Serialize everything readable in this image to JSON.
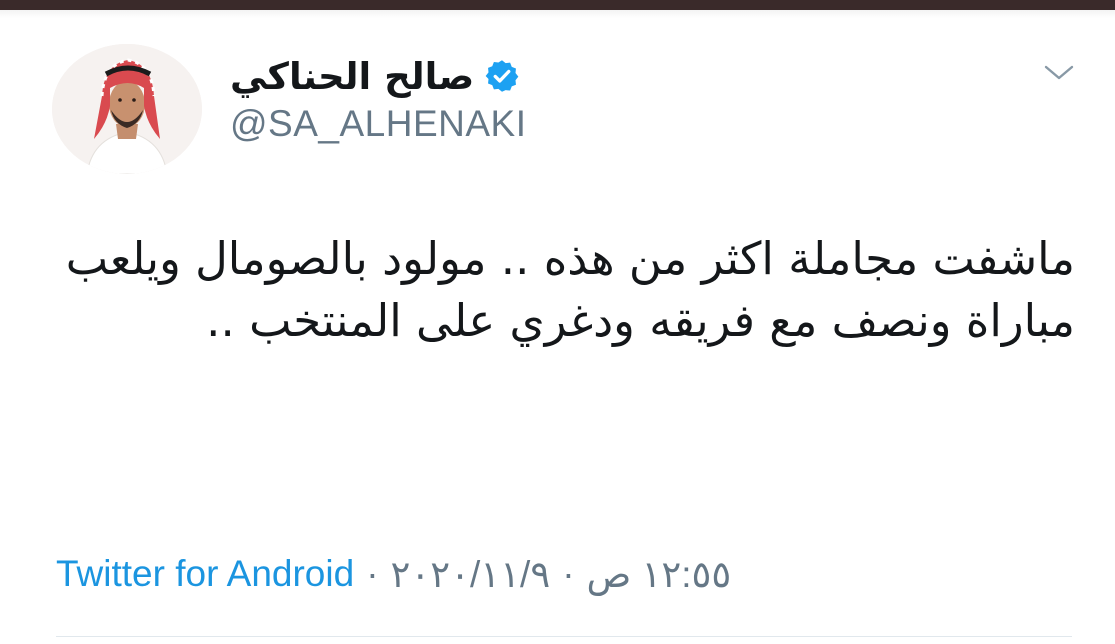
{
  "tweet": {
    "author": {
      "display_name": "صالح الحناكي",
      "handle": "@SA_ALHENAKI",
      "verified": true
    },
    "text": "ماشفت مجاملة اكثر من هذه .. مولود بالصومال ويلعب مباراة ونصف مع فريقه ودغري على المنتخب ..",
    "time": "١٢:٥٥ ص",
    "date": "٢٠٢٠/١١/٩",
    "separator": "·",
    "source": "Twitter for Android"
  },
  "colors": {
    "text": "#14171a",
    "secondary": "#657786",
    "link": "#1b95e0",
    "verified": "#1da1f2"
  },
  "icons": {
    "verified": "verified-badge-icon",
    "menu": "chevron-down-icon"
  }
}
